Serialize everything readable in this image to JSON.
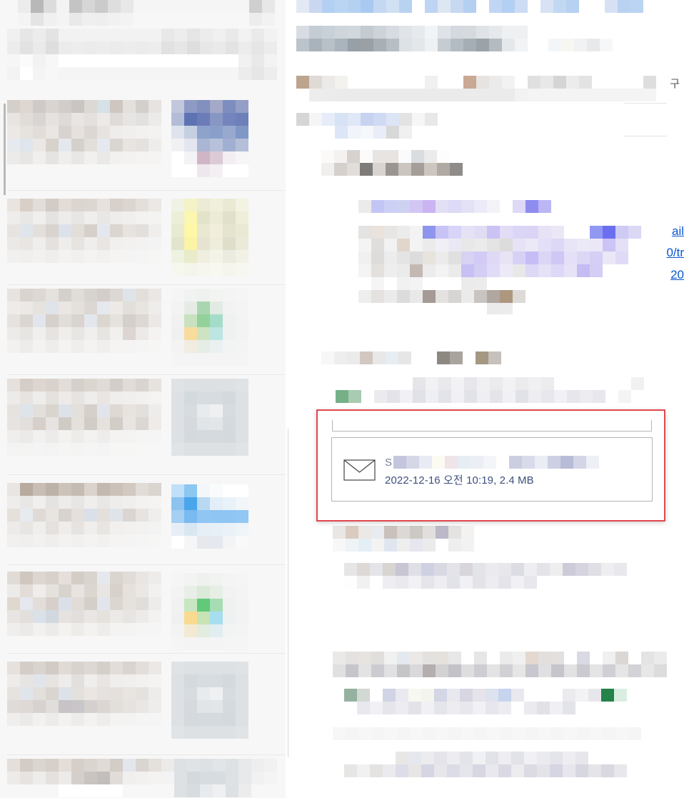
{
  "reading_pane": {
    "edge_glyph": "구",
    "link_fragments": [
      "ail",
      "0/tr",
      "20"
    ]
  },
  "attachment": {
    "name_lead": "S",
    "date_size": "2022-12-16 오전 10:19, 2.4 MB",
    "icon": "mail-envelope-icon"
  },
  "colors": {
    "highlight_border": "#e0474c",
    "meta_text": "#3d4f7d",
    "link": "#0b57d0"
  }
}
